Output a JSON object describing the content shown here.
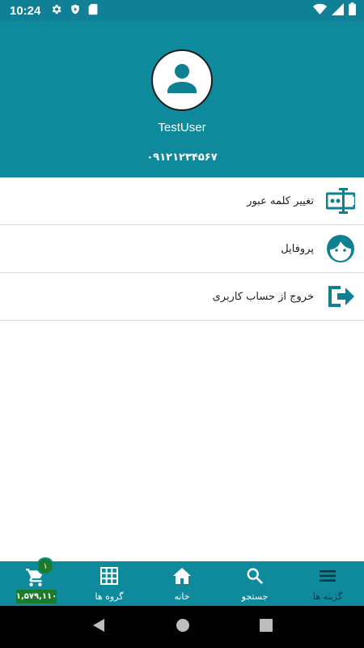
{
  "status_bar": {
    "time": "10:24",
    "icons": [
      "gear-icon",
      "shield-icon",
      "sd-card-icon"
    ],
    "right_icons": [
      "wifi-icon",
      "signal-icon",
      "battery-icon"
    ]
  },
  "profile": {
    "username": "TestUser",
    "phone": "۰۹۱۲۱۲۳۴۵۶۷"
  },
  "menu": {
    "items": [
      {
        "label": "تغییر کلمه عبور",
        "icon": "password-icon"
      },
      {
        "label": "پروفایل",
        "icon": "face-icon"
      },
      {
        "label": "خروج از حساب کاربری",
        "icon": "logout-icon"
      }
    ]
  },
  "bottom_nav": {
    "cart": {
      "badge": "۱",
      "price": "۱,۵۷۹,۱۱۰",
      "icon": "cart-icon"
    },
    "items": [
      {
        "label": "گروه ها",
        "icon": "grid-icon"
      },
      {
        "label": "خانه",
        "icon": "home-icon"
      },
      {
        "label": "جستجو",
        "icon": "search-icon"
      },
      {
        "label": "گزینه ها",
        "icon": "menu-icon"
      }
    ]
  },
  "colors": {
    "primary": "#0f8a9d",
    "accent_green": "#1c7b2a",
    "icon_teal": "#0f7f92"
  }
}
